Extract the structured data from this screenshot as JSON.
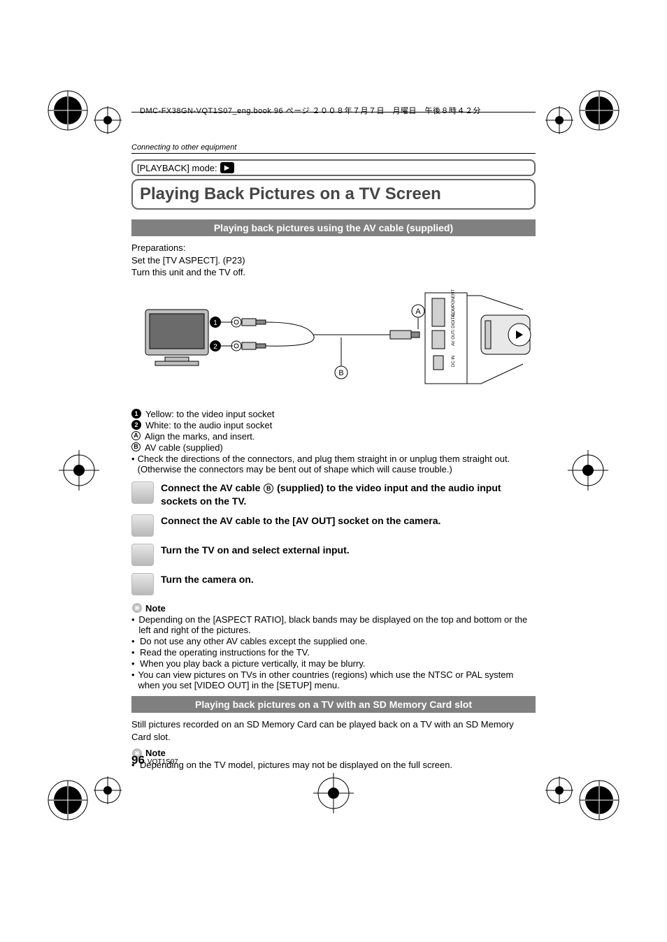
{
  "header_line": "DMC-FX38GN-VQT1S07_eng.book  96 ページ  ２００８年７月７日　月曜日　午後８時４２分",
  "running_head": "Connecting to other equipment",
  "mode_label": "[PLAYBACK] mode:",
  "title": "Playing Back Pictures on a TV Screen",
  "section1": "Playing back pictures using the AV cable (supplied)",
  "prep": {
    "l1": "Preparations:",
    "l2": "Set the [TV ASPECT]. (P23)",
    "l3": "Turn this unit and the TV off."
  },
  "legend": {
    "n1": "Yellow:  to the video input socket",
    "n2": "White:  to the audio input socket",
    "a": "Align the marks, and insert.",
    "b": "AV cable (supplied)"
  },
  "cautions": {
    "c1": "Check the directions of the connectors, and plug them straight in or unplug them straight out. (Otherwise the connectors may be bent out of shape which will cause trouble.)"
  },
  "steps": {
    "s1a": "Connect the AV cable ",
    "s1b": " (supplied) to the video input and the audio input sockets on the TV.",
    "s2": "Connect the AV cable to the [AV OUT] socket on the camera.",
    "s3": "Turn the TV on and select external input.",
    "s4": "Turn the camera on."
  },
  "note_label": "Note",
  "notes1": {
    "n1": "Depending on the [ASPECT RATIO], black bands may be displayed on the top and bottom or the left and right of the pictures.",
    "n2": "Do not use any other AV cables except the supplied one.",
    "n3": "Read the operating instructions for the TV.",
    "n4": "When you play back a picture vertically, it may be blurry.",
    "n5": "You can view pictures on TVs in other countries (regions) which use the NTSC or PAL system when you set [VIDEO OUT] in the [SETUP] menu."
  },
  "section2": "Playing back pictures on a TV with an SD Memory Card slot",
  "sd_text": "Still pictures recorded on an SD Memory Card can be played back on a TV with an SD Memory Card slot.",
  "notes2": {
    "n1": "Depending on the TV model, pictures may not be displayed on the full screen."
  },
  "page_number": "96",
  "doc_code": "VQT1S07"
}
